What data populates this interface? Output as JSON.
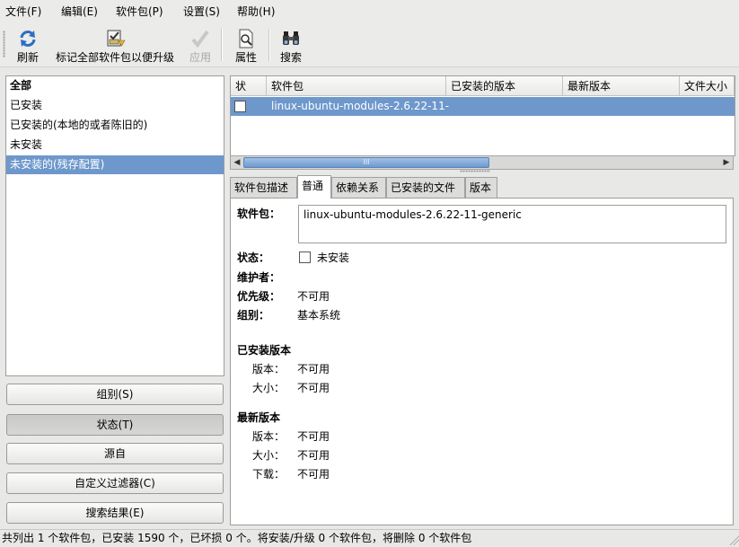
{
  "menubar": {
    "items": [
      "文件(F)",
      "编辑(E)",
      "软件包(P)",
      "设置(S)",
      "帮助(H)"
    ]
  },
  "toolbar": {
    "refresh_label": "刷新",
    "mark_upgrades_label": "标记全部软件包以便升级",
    "apply_label": "应用",
    "properties_label": "属性",
    "search_label": "搜索"
  },
  "filters": {
    "items": [
      "全部",
      "已安装",
      "已安装的(本地的或者陈旧的)",
      "未安装",
      "未安装的(残存配置)"
    ],
    "selected": "未安装的(残存配置)"
  },
  "filter_buttons": {
    "sections": "组别(S)",
    "status": "状态(T)",
    "origin": "源自",
    "custom": "自定义过滤器(C)",
    "search_results": "搜索结果(E)"
  },
  "package_table": {
    "columns": [
      "状",
      "软件包",
      "已安装的版本",
      "最新版本",
      "文件大小"
    ],
    "rows": [
      {
        "name": "linux-ubuntu-modules-2.6.22-11-",
        "installed_version": "",
        "latest_version": "",
        "size": ""
      }
    ]
  },
  "scrollbar": {
    "thumb_grip": "III"
  },
  "tabs": [
    "软件包描述",
    "普通",
    "依赖关系",
    "已安装的文件",
    "版本"
  ],
  "active_tab": "普通",
  "details": {
    "package_label": "软件包：",
    "package_value": "linux-ubuntu-modules-2.6.22-11-generic",
    "status_label": "状态：",
    "status_value": "未安装",
    "maintainer_label": "维护者：",
    "maintainer_value": "",
    "priority_label": "优先级：",
    "priority_value": "不可用",
    "section_label": "组别：",
    "section_value": "基本系统",
    "installed_heading": "已安装版本",
    "installed_version_label": "版本：",
    "installed_version_value": "不可用",
    "installed_size_label": "大小：",
    "installed_size_value": "不可用",
    "latest_heading": "最新版本",
    "latest_version_label": "版本：",
    "latest_version_value": "不可用",
    "latest_size_label": "大小：",
    "latest_size_value": "不可用",
    "download_label": "下载：",
    "download_value": "不可用"
  },
  "statusbar": {
    "text": "共列出 1 个软件包，已安装 1590 个，已坏损 0 个。将安装/升级 0 个软件包，将删除 0 个软件包"
  },
  "colors": {
    "selection": "#6e98cc",
    "window_bg": "#e8e8e7"
  }
}
